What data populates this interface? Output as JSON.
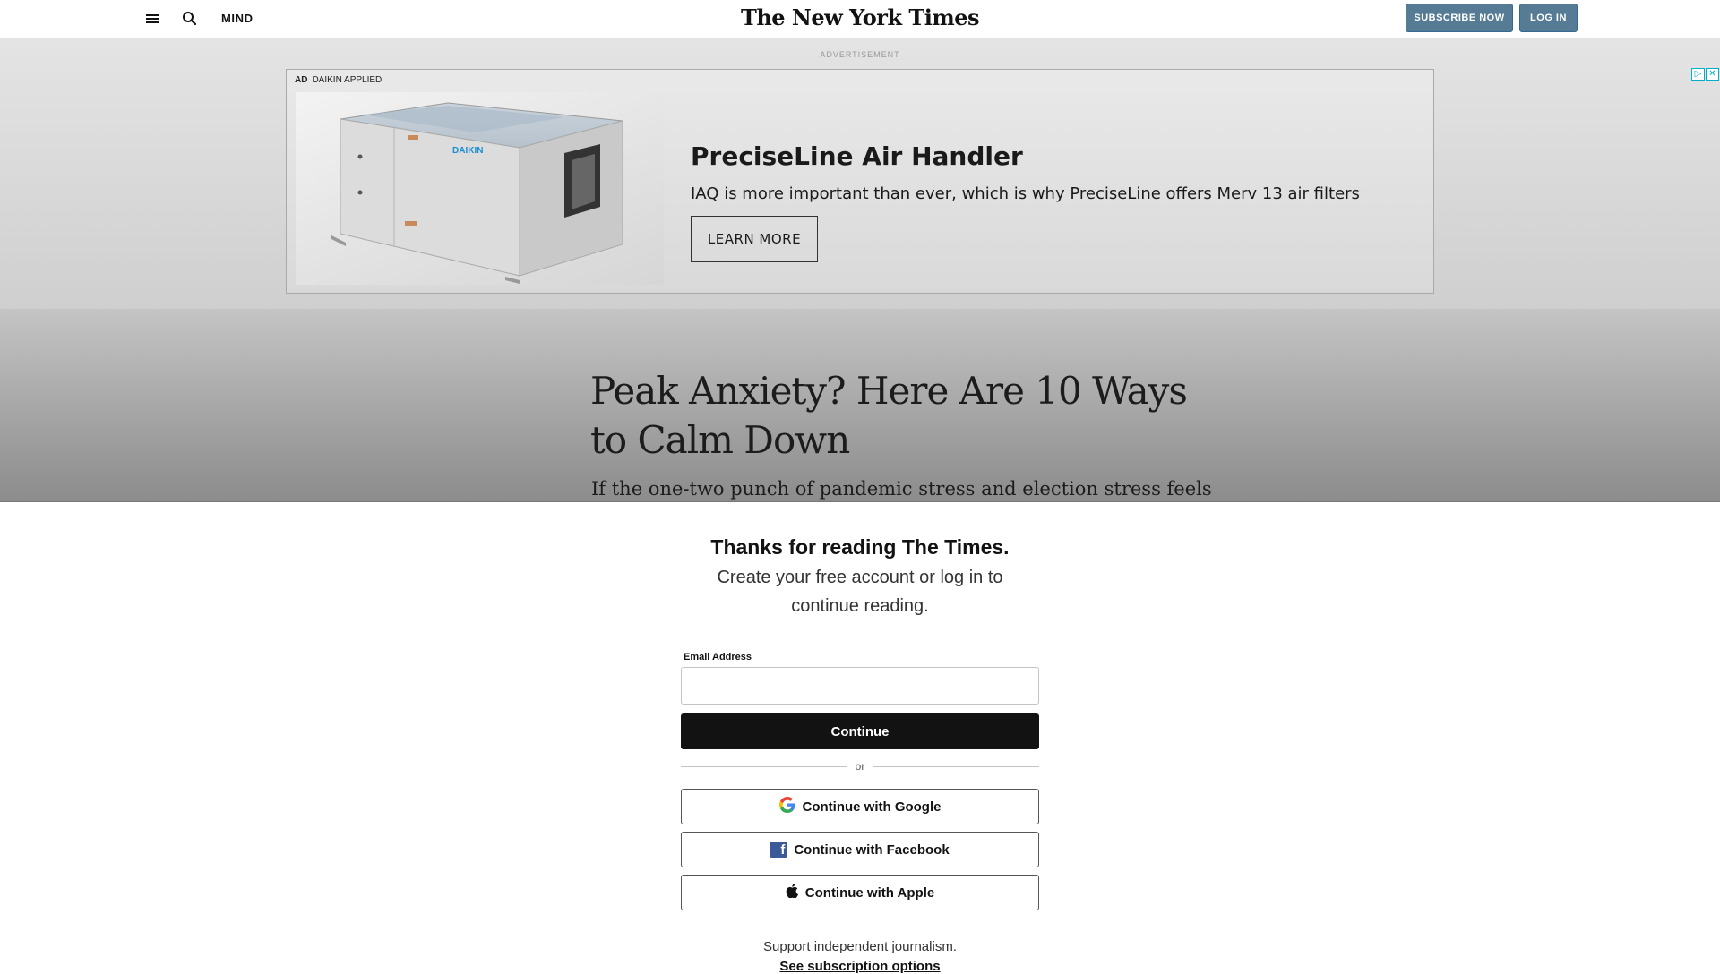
{
  "header": {
    "section": "MIND",
    "logo": "The New York Times",
    "subscribe_label": "SUBSCRIBE NOW",
    "login_label": "LOG IN"
  },
  "ad": {
    "label": "ADVERTISEMENT",
    "tag": "AD",
    "advertiser": "DAIKIN APPLIED",
    "image_brand": "DAIKIN",
    "headline": "PreciseLine Air Handler",
    "body": "IAQ is more important than ever, which is why PreciseLine offers Merv 13 air filters",
    "cta": "LEARN MORE",
    "adchoices_icon": "▷",
    "close_icon": "✕"
  },
  "article": {
    "headline": "Peak Anxiety? Here Are 10 Ways to Calm Down",
    "dek": "If the one-two punch of pandemic stress and election stress feels"
  },
  "regwall": {
    "title": "Thanks for reading The Times.",
    "subtitle": "Create your free account or log in to continue reading.",
    "email_label": "Email Address",
    "email_value": "",
    "continue_label": "Continue",
    "or_label": "or",
    "google_label": "Continue with Google",
    "facebook_label": "Continue with Facebook",
    "apple_label": "Continue with Apple",
    "support_text": "Support independent journalism.",
    "subscription_link": "See subscription options"
  },
  "colors": {
    "header_button": "#567b95",
    "continue_button": "#121212",
    "facebook_blue": "#3b5998"
  }
}
